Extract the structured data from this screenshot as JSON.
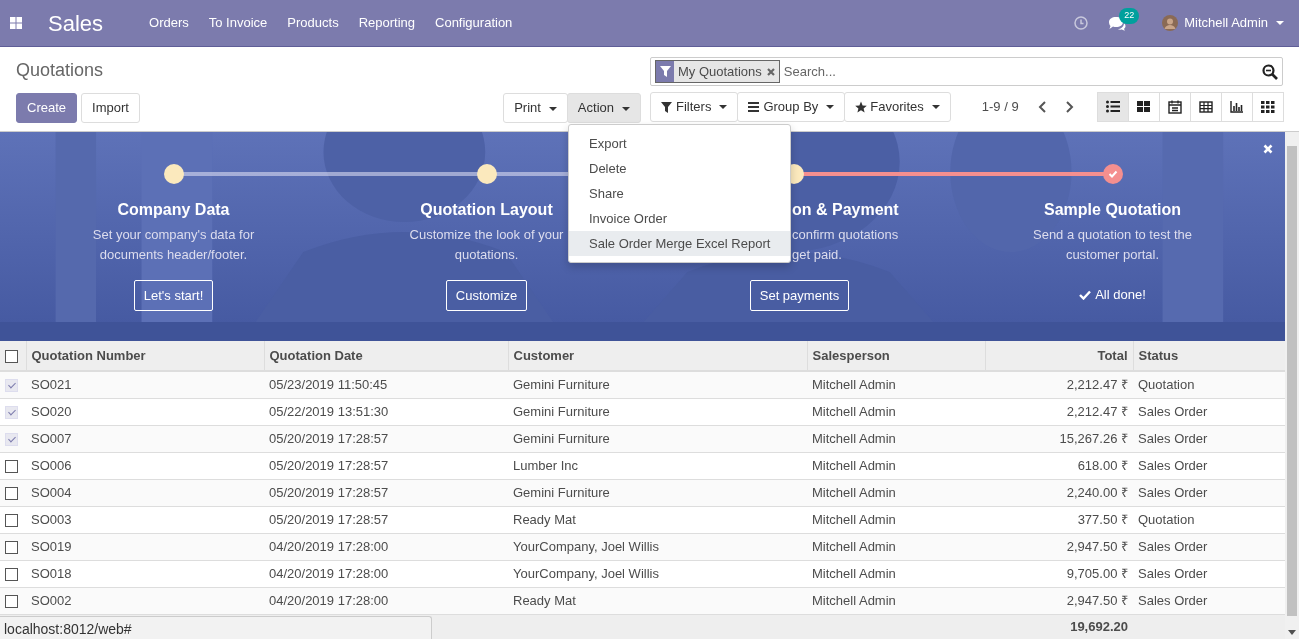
{
  "app": {
    "title": "Sales",
    "menu": [
      "Orders",
      "To Invoice",
      "Products",
      "Reporting",
      "Configuration"
    ]
  },
  "systray": {
    "message_count": "22",
    "user": "Mitchell Admin"
  },
  "breadcrumb": "Quotations",
  "main_buttons": [
    {
      "label": "Create",
      "kind": "primary"
    },
    {
      "label": "Import",
      "kind": "secondary"
    }
  ],
  "sidebar_buttons": [
    {
      "label": "Print",
      "open": false
    },
    {
      "label": "Action",
      "open": true
    }
  ],
  "action_menu": [
    {
      "label": "Export",
      "selected": false
    },
    {
      "label": "Delete",
      "selected": false
    },
    {
      "label": "Share",
      "selected": false
    },
    {
      "label": "Invoice Order",
      "selected": false
    },
    {
      "label": "Sale Order Merge Excel Report",
      "selected": true
    }
  ],
  "search": {
    "facets": [
      {
        "label": "My Quotations"
      }
    ],
    "placeholder": "Search..."
  },
  "search_options": [
    {
      "label": "Filters",
      "kind": "filter"
    },
    {
      "label": "Group By",
      "kind": "groupby"
    },
    {
      "label": "Favorites",
      "kind": "favorites"
    }
  ],
  "pager": "1-9 / 9",
  "views": [
    {
      "kind": "list",
      "selected": true
    },
    {
      "kind": "kanban",
      "selected": false
    },
    {
      "kind": "calendar",
      "selected": false
    },
    {
      "kind": "pivot",
      "selected": false
    },
    {
      "kind": "graph",
      "selected": false
    },
    {
      "kind": "activity",
      "selected": false
    }
  ],
  "banner": {
    "steps": [
      {
        "kind": "open",
        "title": "Company Data",
        "description": "Set your company's data for\ndocuments header/footer.",
        "button": "Let's start!",
        "done": false
      },
      {
        "kind": "open",
        "title": "Quotation Layout",
        "description": "Customize the look of your\nquotations.",
        "button": "Customize",
        "done": false
      },
      {
        "kind": "covered",
        "title": "on & Payment",
        "description": "confirm quotations\nget paid.",
        "button": "Set payments",
        "done": false
      },
      {
        "kind": "open",
        "title": "Sample Quotation",
        "description": "Send a quotation to test the\ncustomer portal.",
        "done_label": "All done!",
        "done": true
      }
    ]
  },
  "table": {
    "all_selected": false,
    "columns": [
      {
        "label": "Quotation Number",
        "numeric": false
      },
      {
        "label": "Quotation Date",
        "numeric": false
      },
      {
        "label": "Customer",
        "numeric": false
      },
      {
        "label": "Salesperson",
        "numeric": false
      },
      {
        "label": "Total",
        "numeric": true
      },
      {
        "label": "Status",
        "numeric": false
      }
    ],
    "rows": [
      {
        "checked": true,
        "cells": [
          "SO021",
          "05/23/2019 11:50:45",
          "Gemini Furniture",
          "Mitchell Admin",
          "2,212.47 ₹",
          "Quotation"
        ]
      },
      {
        "checked": true,
        "cells": [
          "SO020",
          "05/22/2019 13:51:30",
          "Gemini Furniture",
          "Mitchell Admin",
          "2,212.47 ₹",
          "Sales Order"
        ]
      },
      {
        "checked": true,
        "cells": [
          "SO007",
          "05/20/2019 17:28:57",
          "Gemini Furniture",
          "Mitchell Admin",
          "15,267.26 ₹",
          "Sales Order"
        ]
      },
      {
        "checked": false,
        "cells": [
          "SO006",
          "05/20/2019 17:28:57",
          "Lumber Inc",
          "Mitchell Admin",
          "618.00 ₹",
          "Sales Order"
        ]
      },
      {
        "checked": false,
        "cells": [
          "SO004",
          "05/20/2019 17:28:57",
          "Gemini Furniture",
          "Mitchell Admin",
          "2,240.00 ₹",
          "Sales Order"
        ]
      },
      {
        "checked": false,
        "cells": [
          "SO003",
          "05/20/2019 17:28:57",
          "Ready Mat",
          "Mitchell Admin",
          "377.50 ₹",
          "Quotation"
        ]
      },
      {
        "checked": false,
        "cells": [
          "SO019",
          "04/20/2019 17:28:00",
          "YourCompany, Joel Willis",
          "Mitchell Admin",
          "2,947.50 ₹",
          "Sales Order"
        ]
      },
      {
        "checked": false,
        "cells": [
          "SO018",
          "04/20/2019 17:28:00",
          "YourCompany, Joel Willis",
          "Mitchell Admin",
          "9,705.00 ₹",
          "Sales Order"
        ]
      },
      {
        "checked": false,
        "cells": [
          "SO002",
          "04/20/2019 17:28:00",
          "Ready Mat",
          "Mitchell Admin",
          "2,947.50 ₹",
          "Sales Order"
        ]
      }
    ],
    "footer_total": "19,692.20"
  },
  "browser_status": "localhost:8012/web#"
}
